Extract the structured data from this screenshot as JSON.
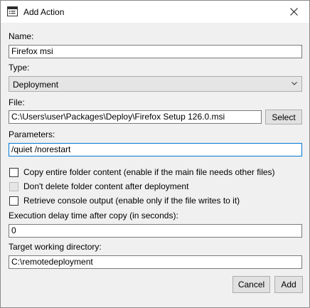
{
  "window": {
    "title": "Add Action",
    "icon": "app-window-icon",
    "close_icon": "close-icon"
  },
  "form": {
    "name_label": "Name:",
    "name_value": "Firefox msi",
    "type_label": "Type:",
    "type_value": "Deployment",
    "file_label": "File:",
    "file_value": "C:\\Users\\user\\Packages\\Deploy\\Firefox Setup 126.0.msi",
    "select_label": "Select",
    "parameters_label": "Parameters:",
    "parameters_value": "/quiet /norestart",
    "checkboxes": [
      {
        "label": "Copy entire folder content (enable if the main file needs other files)",
        "checked": false,
        "enabled": true
      },
      {
        "label": "Don't delete folder content after deployment",
        "checked": false,
        "enabled": false
      },
      {
        "label": "Retrieve console output (enable only if the file writes to it)",
        "checked": false,
        "enabled": true
      }
    ],
    "delay_label": "Execution delay time after copy (in seconds):",
    "delay_value": "0",
    "workdir_label": "Target working directory:",
    "workdir_value": "C:\\remotedeployment"
  },
  "buttons": {
    "cancel": "Cancel",
    "add": "Add"
  },
  "colors": {
    "focus_border": "#0078d7",
    "window_bg": "#f0f0f0"
  }
}
